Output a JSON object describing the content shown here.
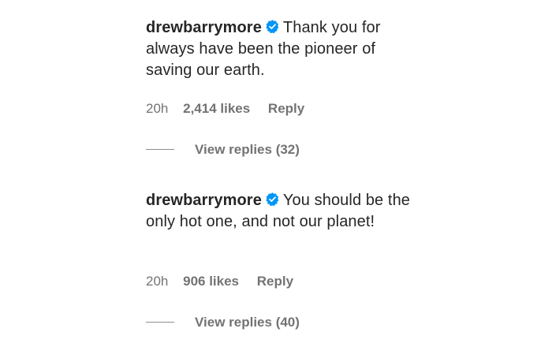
{
  "colors": {
    "text": "#262626",
    "meta": "#737373",
    "verified_badge": "#0095f6"
  },
  "comments": [
    {
      "username": "drewbarrymore",
      "verified_icon": "verified-badge-icon",
      "text": "Thank you for always have been the pioneer of saving our earth.",
      "time": "20h",
      "likes": "2,414 likes",
      "reply": "Reply",
      "view_replies": "View replies (32)"
    },
    {
      "username": "drewbarrymore",
      "verified_icon": "verified-badge-icon",
      "text": "You should be the only hot one, and not our planet!",
      "time": "20h",
      "likes": "906 likes",
      "reply": "Reply",
      "view_replies": "View replies (40)"
    }
  ]
}
